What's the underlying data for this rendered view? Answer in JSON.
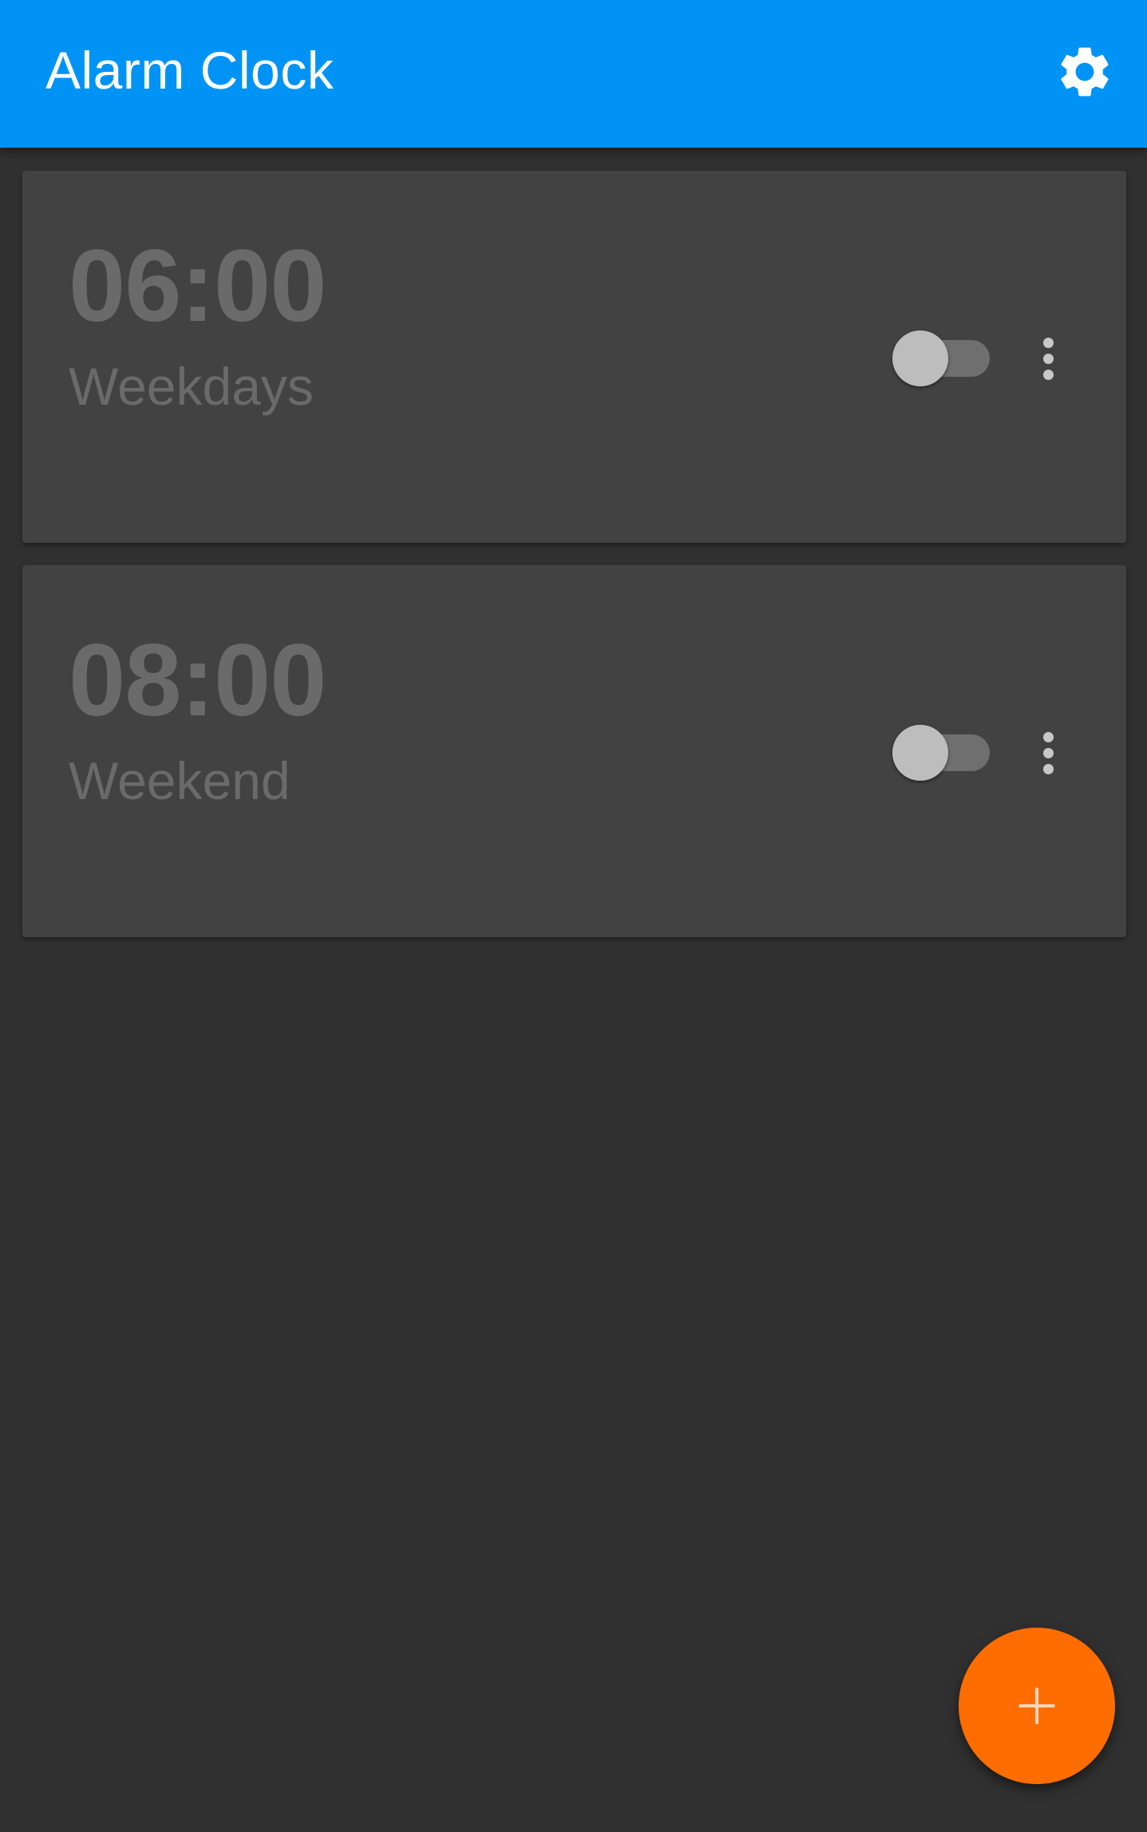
{
  "app_bar": {
    "title": "Alarm Clock",
    "settings_icon": "gear-icon",
    "background_color": "#0093f6"
  },
  "alarms": [
    {
      "time": "06:00",
      "label": "Weekdays",
      "enabled": false
    },
    {
      "time": "08:00",
      "label": "Weekend",
      "enabled": false
    }
  ],
  "fab": {
    "icon": "plus-icon",
    "color": "#ff6d00"
  },
  "colors": {
    "background": "#303030",
    "card": "#424242",
    "disabled_text": "#6a6a6a"
  }
}
